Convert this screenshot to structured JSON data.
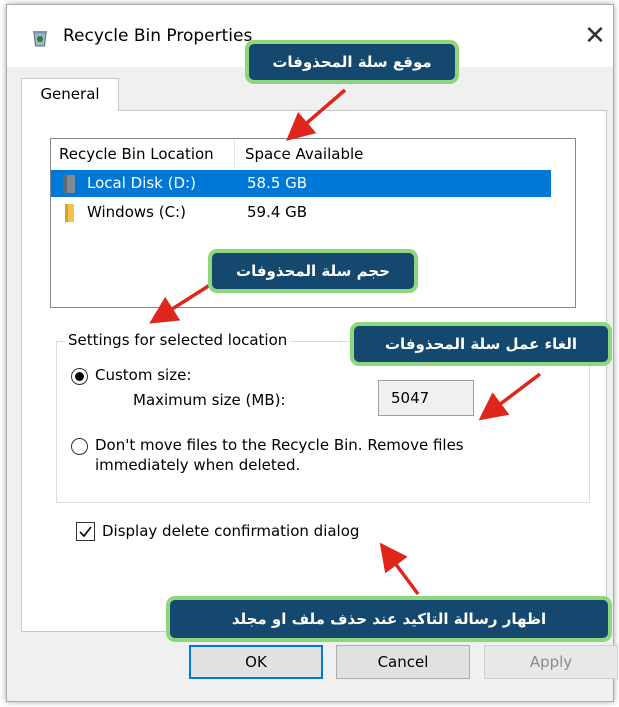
{
  "window": {
    "title": "Recycle Bin Properties",
    "close_glyph": "✕"
  },
  "tabs": [
    {
      "label": "General",
      "selected": true
    }
  ],
  "location_list": {
    "columns": [
      "Recycle Bin Location",
      "Space Available"
    ],
    "rows": [
      {
        "name": "Local Disk (D:)",
        "space": "58.5 GB",
        "icon": "drive-icon",
        "selected": true
      },
      {
        "name": "Windows (C:)",
        "space": "59.4 GB",
        "icon": "folder-icon",
        "selected": false
      }
    ]
  },
  "settings": {
    "group_title": "Settings for selected location",
    "custom_size": {
      "label": "Custom size:",
      "checked": true
    },
    "max_size": {
      "label": "Maximum size (MB):",
      "value": "5047"
    },
    "no_move": {
      "label_line1": "Don't move files to the Recycle Bin. Remove files",
      "label_line2": "immediately when deleted.",
      "checked": false
    }
  },
  "confirm": {
    "label": "Display delete confirmation dialog",
    "checked": true
  },
  "buttons": {
    "ok": "OK",
    "cancel": "Cancel",
    "apply": "Apply"
  },
  "annotations": {
    "location": "موقع سلة المحذوفات",
    "size": "حجم سلة المحذوفات",
    "disable": "الغاء عمل سلة المحذوفات",
    "confirm": "اظهار رسالة التاكيد عند حذف ملف او مجلد"
  },
  "colors": {
    "selection": "#0078d7",
    "annotation_fill": "#14486e",
    "annotation_border": "#8dd67b",
    "arrow": "#e0261b"
  }
}
